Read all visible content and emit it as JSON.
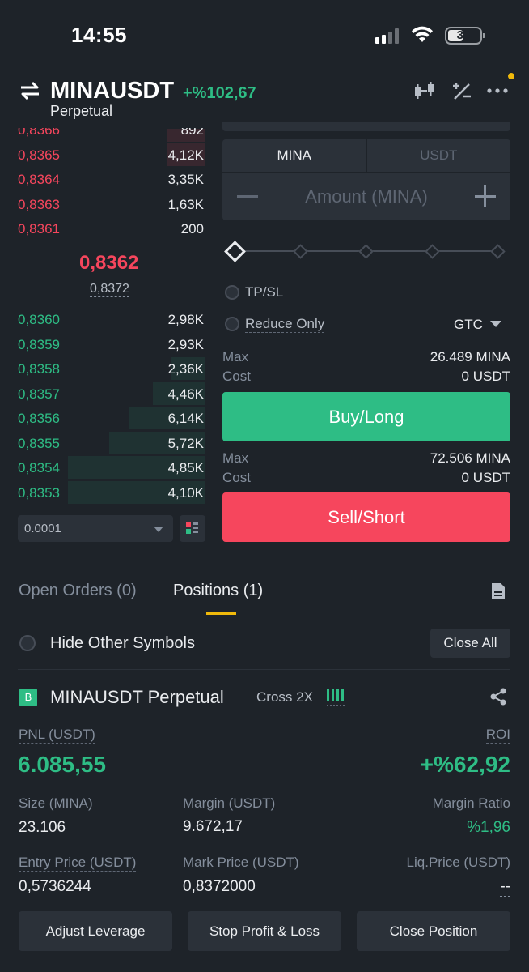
{
  "status_bar": {
    "time": "14:55",
    "battery": "33"
  },
  "header": {
    "symbol": "MINAUSDT",
    "change": "+%102,67",
    "contract": "Perpetual"
  },
  "orderbook": {
    "asks": [
      {
        "price": "0,8366",
        "qty": "892",
        "depth": 0.28
      },
      {
        "price": "0,8365",
        "qty": "4,12K",
        "depth": 0.28
      },
      {
        "price": "0,8364",
        "qty": "3,35K",
        "depth": 0
      },
      {
        "price": "0,8363",
        "qty": "1,63K",
        "depth": 0
      },
      {
        "price": "0,8361",
        "qty": "200",
        "depth": 0
      }
    ],
    "last_price": "0,8362",
    "mark_price": "0,8372",
    "bids": [
      {
        "price": "0,8360",
        "qty": "2,98K",
        "depth": 0
      },
      {
        "price": "0,8359",
        "qty": "2,93K",
        "depth": 0
      },
      {
        "price": "0,8358",
        "qty": "2,36K",
        "depth": 0.25
      },
      {
        "price": "0,8357",
        "qty": "4,46K",
        "depth": 0.38
      },
      {
        "price": "0,8356",
        "qty": "6,14K",
        "depth": 0.56
      },
      {
        "price": "0,8355",
        "qty": "5,72K",
        "depth": 0.7
      },
      {
        "price": "0,8354",
        "qty": "4,85K",
        "depth": 1.0
      },
      {
        "price": "0,8353",
        "qty": "4,10K",
        "depth": 1.0
      }
    ],
    "tick_size": "0.0001"
  },
  "order_form": {
    "unit_tabs": [
      "MINA",
      "USDT"
    ],
    "amount_placeholder": "Amount (MINA)",
    "tpsl_label": "TP/SL",
    "reduce_only_label": "Reduce Only",
    "time_in_force": "GTC",
    "buy": {
      "max_label": "Max",
      "max_value": "26.489 MINA",
      "cost_label": "Cost",
      "cost_value": "0 USDT",
      "button": "Buy/Long"
    },
    "sell": {
      "max_label": "Max",
      "max_value": "72.506 MINA",
      "cost_label": "Cost",
      "cost_value": "0 USDT",
      "button": "Sell/Short"
    }
  },
  "tabs": {
    "open_orders": "Open Orders (0)",
    "positions": "Positions (1)"
  },
  "positions_toolbar": {
    "hide_other": "Hide Other Symbols",
    "close_all": "Close All"
  },
  "position": {
    "side_badge": "B",
    "symbol": "MINAUSDT Perpetual",
    "mode": "Cross 2X",
    "pnl_label": "PNL (USDT)",
    "pnl_value": "6.085,55",
    "roi_label": "ROI",
    "roi_value": "+%62,92",
    "size_label": "Size (MINA)",
    "size_value": "23.106",
    "margin_label": "Margin (USDT)",
    "margin_value": "9.672,17",
    "margin_ratio_label": "Margin Ratio",
    "margin_ratio_value": "%1,96",
    "entry_label": "Entry Price (USDT)",
    "entry_value": "0,5736244",
    "mark_label": "Mark Price (USDT)",
    "mark_value": "0,8372000",
    "liq_label": "Liq.Price (USDT)",
    "liq_value": "--",
    "actions": [
      "Adjust Leverage",
      "Stop Profit & Loss",
      "Close Position"
    ]
  },
  "colors": {
    "buy": "#2ebd85",
    "sell": "#f6465d",
    "accent": "#f0b90b",
    "bg": "#1e2329",
    "panel": "#2b3139"
  }
}
